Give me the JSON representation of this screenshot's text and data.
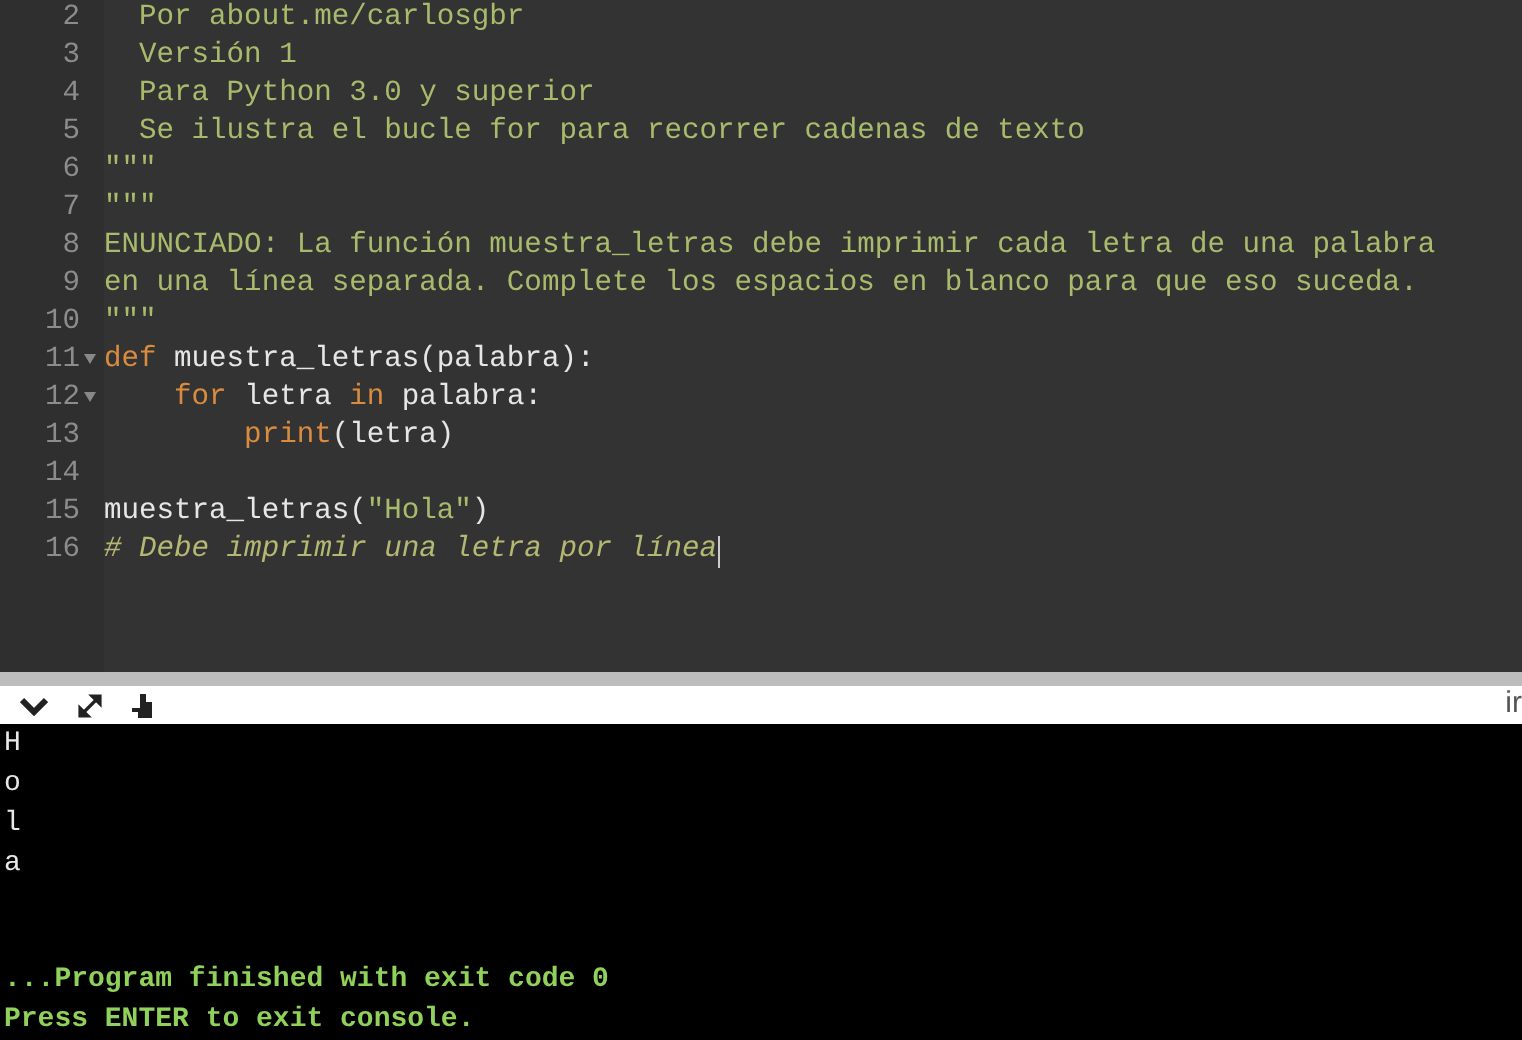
{
  "editor": {
    "lines": [
      {
        "number": "2",
        "fold": false,
        "cursor": false,
        "tokens": [
          {
            "kind": "string",
            "text": "  Por about.me/carlosgbr"
          }
        ]
      },
      {
        "number": "3",
        "fold": false,
        "cursor": false,
        "tokens": [
          {
            "kind": "string",
            "text": "  Versión 1"
          }
        ]
      },
      {
        "number": "4",
        "fold": false,
        "cursor": false,
        "tokens": [
          {
            "kind": "string",
            "text": "  Para Python 3.0 y superior"
          }
        ]
      },
      {
        "number": "5",
        "fold": false,
        "cursor": false,
        "tokens": [
          {
            "kind": "string",
            "text": "  Se ilustra el bucle for para recorrer cadenas de texto"
          }
        ]
      },
      {
        "number": "6",
        "fold": false,
        "cursor": false,
        "tokens": [
          {
            "kind": "string",
            "text": "\"\"\""
          }
        ]
      },
      {
        "number": "7",
        "fold": false,
        "cursor": false,
        "tokens": [
          {
            "kind": "string",
            "text": "\"\"\""
          }
        ]
      },
      {
        "number": "8",
        "fold": false,
        "cursor": false,
        "tokens": [
          {
            "kind": "string",
            "text": "ENUNCIADO: La función muestra_letras debe imprimir cada letra de una palabra"
          }
        ]
      },
      {
        "number": "9",
        "fold": false,
        "cursor": false,
        "tokens": [
          {
            "kind": "string",
            "text": "en una línea separada. Complete los espacios en blanco para que eso suceda."
          }
        ]
      },
      {
        "number": "10",
        "fold": false,
        "cursor": false,
        "tokens": [
          {
            "kind": "string",
            "text": "\"\"\""
          }
        ]
      },
      {
        "number": "11",
        "fold": true,
        "cursor": false,
        "tokens": [
          {
            "kind": "keyword",
            "text": "def"
          },
          {
            "kind": "plain",
            "text": " muestra_letras(palabra):"
          }
        ]
      },
      {
        "number": "12",
        "fold": true,
        "cursor": false,
        "tokens": [
          {
            "kind": "keyword",
            "text": "    for"
          },
          {
            "kind": "plain",
            "text": " letra "
          },
          {
            "kind": "keyword",
            "text": "in"
          },
          {
            "kind": "plain",
            "text": " palabra:"
          }
        ]
      },
      {
        "number": "13",
        "fold": false,
        "cursor": false,
        "tokens": [
          {
            "kind": "keyword",
            "text": "        print"
          },
          {
            "kind": "plain",
            "text": "(letra)"
          }
        ]
      },
      {
        "number": "14",
        "fold": false,
        "cursor": false
      },
      {
        "number": "15",
        "fold": false,
        "cursor": false,
        "tokens": [
          {
            "kind": "plain",
            "text": "muestra_letras("
          },
          {
            "kind": "string",
            "text": "\"Hola\""
          },
          {
            "kind": "plain",
            "text": ")"
          }
        ]
      },
      {
        "number": "16",
        "fold": false,
        "cursor": true,
        "tokens": [
          {
            "kind": "comment",
            "text": "# Debe imprimir una letra por línea"
          }
        ]
      }
    ]
  },
  "console_toolbar": {
    "right_text": "ir"
  },
  "console": {
    "lines": [
      {
        "kind": "output",
        "text": "H"
      },
      {
        "kind": "output",
        "text": "o"
      },
      {
        "kind": "output",
        "text": "l"
      },
      {
        "kind": "output",
        "text": "a"
      },
      {
        "kind": "status",
        "text": "...Program finished with exit code 0"
      },
      {
        "kind": "status",
        "text": "Press ENTER to exit console."
      }
    ]
  }
}
